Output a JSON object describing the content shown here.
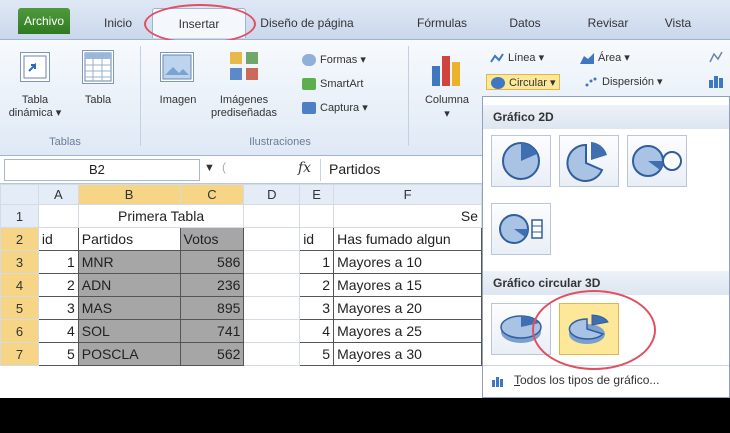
{
  "tabs": {
    "archivo": "Archivo",
    "inicio": "Inicio",
    "insertar": "Insertar",
    "diseno": "Diseño de página",
    "formulas": "Fórmulas",
    "datos": "Datos",
    "revisar": "Revisar",
    "vista": "Vista"
  },
  "ribbon": {
    "tabla_dinamica_line1": "Tabla",
    "tabla_dinamica_line2": "dinámica ▾",
    "tabla": "Tabla",
    "tablas_group": "Tablas",
    "imagen": "Imagen",
    "imagenes_line1": "Imágenes",
    "imagenes_line2": "prediseñadas",
    "formas": "Formas ▾",
    "smartart": "SmartArt",
    "captura": "Captura ▾",
    "ilustraciones_group": "Ilustraciones",
    "columna": "Columna",
    "columna_arrow": "▾",
    "linea": "Línea ▾",
    "area": "Área ▾",
    "circular": "Circular ▾",
    "dispersion": "Dispersión ▾"
  },
  "formula_bar": {
    "name_box": "B2",
    "fx": "fx",
    "formula": "Partidos"
  },
  "sheet": {
    "columns": [
      "A",
      "B",
      "C",
      "D",
      "E",
      "F"
    ],
    "rows": [
      "1",
      "2",
      "3",
      "4",
      "5",
      "6",
      "7"
    ],
    "title1": "Primera Tabla",
    "title2_partial": "Se",
    "hdr_id": "id",
    "hdr_partidos": "Partidos",
    "hdr_votos": "Votos",
    "hdr_id2": "id",
    "hdr_fumado": "Has fumado algun",
    "data1": [
      {
        "id": "1",
        "partido": "MNR",
        "votos": "586"
      },
      {
        "id": "2",
        "partido": "ADN",
        "votos": "236"
      },
      {
        "id": "3",
        "partido": "MAS",
        "votos": "895"
      },
      {
        "id": "4",
        "partido": "SOL",
        "votos": "741"
      },
      {
        "id": "5",
        "partido": "POSCLA",
        "votos": "562"
      }
    ],
    "data2": [
      {
        "id": "1",
        "val": "Mayores a 10"
      },
      {
        "id": "2",
        "val": "Mayores a 15"
      },
      {
        "id": "3",
        "val": "Mayores a 20"
      },
      {
        "id": "4",
        "val": "Mayores a 25"
      },
      {
        "id": "5",
        "val": "Mayores a 30"
      }
    ]
  },
  "dropdown": {
    "grafico_2d": "Gráfico 2D",
    "grafico_3d": "Gráfico circular 3D",
    "todos_prefix": "T",
    "todos_rest": "odos los tipos de gráfico..."
  }
}
